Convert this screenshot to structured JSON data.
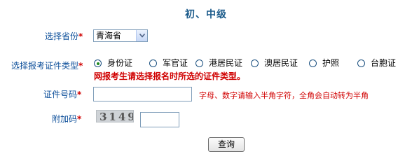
{
  "title": "初、中级",
  "required_mark": "*",
  "province": {
    "label": "选择省份",
    "selected": "青海省"
  },
  "cert_type": {
    "label": "选择报考证件类型",
    "options": [
      {
        "label": "身份证",
        "checked": true
      },
      {
        "label": "军官证",
        "checked": false
      },
      {
        "label": "港居民证",
        "checked": false
      },
      {
        "label": "澳居民证",
        "checked": false
      },
      {
        "label": "护照",
        "checked": false
      },
      {
        "label": "台胞证",
        "checked": false
      }
    ],
    "hint": "网报考生请选择报名时所选的证件类型。"
  },
  "id_number": {
    "label": "证件号码",
    "value": "",
    "hint": "字母、数字请输入半角字符，全角会自动转为半角"
  },
  "captcha": {
    "label": "附加码",
    "image_text": "3149",
    "value": ""
  },
  "submit": {
    "label": "查询"
  },
  "colors": {
    "label_blue": "#0d4f9a",
    "title_blue": "#1a5a8a",
    "hint_red": "#d00000"
  }
}
